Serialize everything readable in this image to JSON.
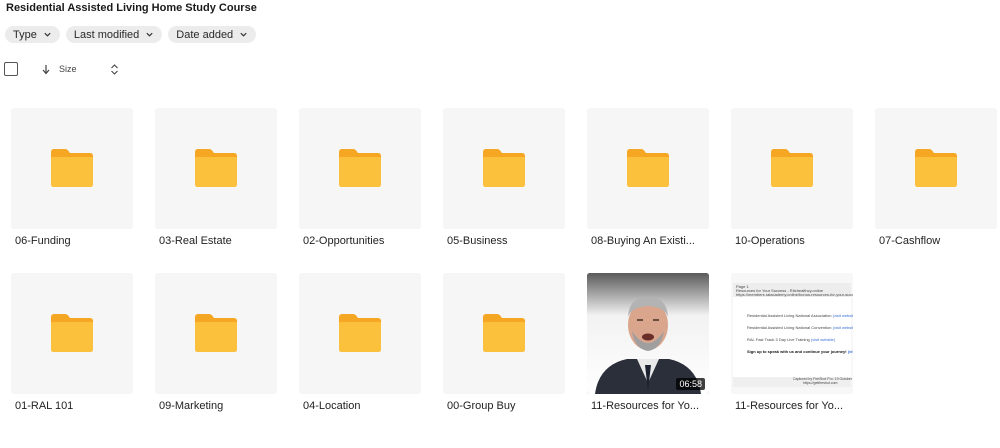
{
  "page": {
    "title": "Residential Assisted Living Home Study Course"
  },
  "filters": [
    {
      "label": "Type"
    },
    {
      "label": "Last modified"
    },
    {
      "label": "Date added"
    }
  ],
  "toolbar": {
    "sort_label": "Size"
  },
  "items": [
    {
      "name": "06-Funding",
      "kind": "folder"
    },
    {
      "name": "03-Real Estate",
      "kind": "folder"
    },
    {
      "name": "02-Opportunities",
      "kind": "folder"
    },
    {
      "name": "05-Business",
      "kind": "folder"
    },
    {
      "name": "08-Buying An Existi...",
      "kind": "folder"
    },
    {
      "name": "10-Operations",
      "kind": "folder"
    },
    {
      "name": "07-Cashflow",
      "kind": "folder"
    },
    {
      "name": "01-RAL 101",
      "kind": "folder"
    },
    {
      "name": "09-Marketing",
      "kind": "folder"
    },
    {
      "name": "04-Location",
      "kind": "folder"
    },
    {
      "name": "00-Group Buy",
      "kind": "folder"
    },
    {
      "name": "11-Resources for Yo...",
      "kind": "video",
      "duration": "06:58"
    },
    {
      "name": "11-Resources for Yo...",
      "kind": "document"
    }
  ],
  "doc_preview": {
    "page_label": "Page 1",
    "header_line_1": "Resources for Your Success - Ritchealthcy.online",
    "header_line_2": "https://members.ralacademy.online/bonus-resources-for-your-success/",
    "line_1": "Residential Assisted Living National Association",
    "line_2": "Residential Assisted Living National Convention",
    "line_3": "RAL Fast Track 3 Day Live Training",
    "link_text": "(visit website)",
    "cta": "Sign up to speak with us and continue your journey!",
    "cta_link": "(visit w",
    "footer_1": "Captured by FireShot Pro: 19 October 202",
    "footer_2": "https://getfireshot.com"
  },
  "colors": {
    "folder_back": "#F5A623",
    "folder_front": "#FBC13C",
    "tile_bg": "#F6F6F6",
    "chip_bg": "#ECECEC"
  }
}
